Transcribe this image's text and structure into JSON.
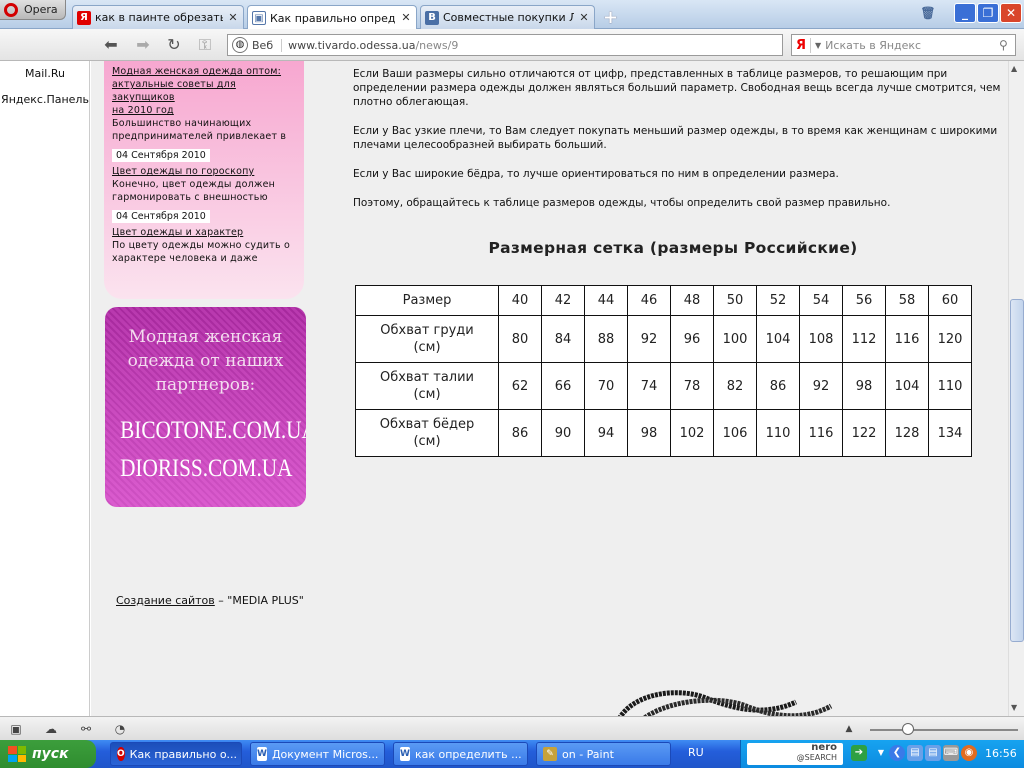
{
  "browser": {
    "menu_label": "Opera",
    "tabs": [
      {
        "title": "как в паинте обрезать ...",
        "favicon": "Я",
        "color": "#e00000"
      },
      {
        "title": "Как правильно опреде...",
        "favicon": "▣",
        "color": "#5577aa"
      },
      {
        "title": "Совместные покупки Л...",
        "favicon": "В",
        "color": "#4a6fa5"
      }
    ],
    "address": {
      "label": "Веб",
      "domain": "www.tivardo.odessa.ua",
      "path": "/news/9"
    },
    "search": {
      "logo": "Я",
      "placeholder": "Искать в Яндекс"
    },
    "panel_items": [
      "Mail.Ru",
      "Яндекс.Панель"
    ]
  },
  "sidebar": {
    "news": [
      {
        "title_lines": [
          "Модная женская одежда оптом:",
          "актуальные советы для закупщиков",
          "на 2010 год"
        ],
        "excerpt_lines": [
          "Большинство начинающих",
          "предпринимателей привлекает в"
        ]
      },
      {
        "date": "04 Сентября 2010",
        "title_lines": [
          "Цвет одежды по гороскопу"
        ],
        "excerpt_lines": [
          "Конечно, цвет одежды должен",
          "гармонировать с внешностью"
        ]
      },
      {
        "date": "04 Сентября 2010",
        "title_lines": [
          "Цвет одежды и характер"
        ],
        "excerpt_lines": [
          "По цвету одежды можно судить о",
          "характере человека и даже"
        ]
      }
    ],
    "promo": {
      "lines": [
        "Модная женская",
        "одежда от наших",
        "партнеров:"
      ],
      "sites": [
        "BICOTONE.COM.UA",
        "DIORISS.COM.UA"
      ]
    }
  },
  "article": {
    "paragraphs": [
      "Если Ваши размеры сильно отличаются от цифр, представленных в таблице размеров, то решающим при определении размера одежды должен являться больший параметр. Свободная вещь всегда лучше смотрится, чем плотно облегающая.",
      "Если у Вас узкие плечи, то Вам следует покупать меньший размер одежды, в то время как женщинам с широкими плечами целесообразней выбирать больший.",
      "Если у Вас широкие бёдра, то лучше ориентироваться по ним в определении размера.",
      "Поэтому, обращайтесь к таблице размеров одежды, чтобы определить свой размер правильно."
    ],
    "table_title": "Размерная сетка (размеры Российские)",
    "table": {
      "header": {
        "label": "Размер",
        "values": [
          "40",
          "42",
          "44",
          "46",
          "48",
          "50",
          "52",
          "54",
          "56",
          "58",
          "60"
        ]
      },
      "rows": [
        {
          "label": [
            "Обхват груди",
            "(см)"
          ],
          "values": [
            "80",
            "84",
            "88",
            "92",
            "96",
            "100",
            "104",
            "108",
            "112",
            "116",
            "120"
          ]
        },
        {
          "label": [
            "Обхват талии",
            "(см)"
          ],
          "values": [
            "62",
            "66",
            "70",
            "74",
            "78",
            "82",
            "86",
            "92",
            "98",
            "104",
            "110"
          ]
        },
        {
          "label": [
            "Обхват бёдер",
            "(см)"
          ],
          "values": [
            "86",
            "90",
            "94",
            "98",
            "102",
            "106",
            "110",
            "116",
            "122",
            "128",
            "134"
          ]
        }
      ]
    }
  },
  "footer": {
    "link": "Создание сайтов",
    "rest": " – \"MEDIA PLUS\""
  },
  "taskbar": {
    "start_label": "пуск",
    "tasks": [
      {
        "label": "Как правильно о...",
        "icon": "O",
        "color": "#d30000"
      },
      {
        "label": "Документ Micros...",
        "icon": "W",
        "color": "#2b5fb3"
      },
      {
        "label": "как определить ...",
        "icon": "W",
        "color": "#2b5fb3"
      },
      {
        "label": "on - Paint",
        "icon": "✎",
        "color": "#c7a23a"
      }
    ],
    "language": "RU",
    "nero_top": "nero",
    "nero_bottom": "@SEARCH",
    "clock": "16:56"
  }
}
